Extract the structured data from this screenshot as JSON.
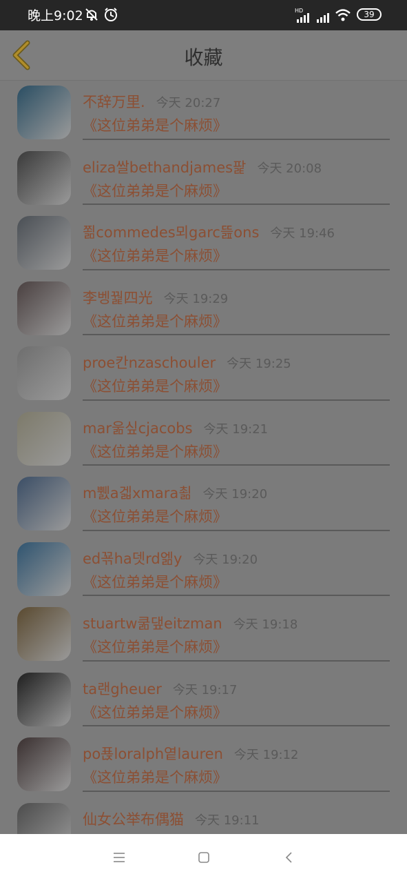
{
  "status": {
    "time": "晚上9:02",
    "battery": "39",
    "icons": [
      "mute-icon",
      "alarm-icon",
      "hd-signal-icon",
      "signal-icon",
      "wifi-icon",
      "battery-icon"
    ]
  },
  "header": {
    "title": "收藏",
    "back_icon": "back-chevron-icon"
  },
  "items": [
    {
      "name": "不辞万里.",
      "time": "今天 20:27",
      "book": "《这位弟弟是个麻烦》",
      "avatar_color": "#2a4e63"
    },
    {
      "name": "eliza쌀bethandjames팙",
      "time": "今天 20:08",
      "book": "《这位弟弟是个麻烦》",
      "avatar_color": "#3a3a3a"
    },
    {
      "name": "쬚commedes뫼garc뜶ons",
      "time": "今天 19:46",
      "book": "《这位弟弟是个麻烦》",
      "avatar_color": "#4a4f55"
    },
    {
      "name": "李벵꿡四光",
      "time": "今天 19:29",
      "book": "《这位弟弟是个麻烦》",
      "avatar_color": "#4a4040"
    },
    {
      "name": "proe칸nzaschouler",
      "time": "今天 19:25",
      "book": "《这位弟弟是个麻烦》",
      "avatar_color": "#6e6e6e"
    },
    {
      "name": "mar욺싶cjacobs",
      "time": "今天 19:21",
      "book": "《这位弟弟是个麻烦》",
      "avatar_color": "#7d7a6a"
    },
    {
      "name": "m쀐a겗xmara쵦",
      "time": "今天 19:20",
      "book": "《这位弟弟是个麻烦》",
      "avatar_color": "#3b4e66"
    },
    {
      "name": "ed꾞ha뎃rd엚y",
      "time": "今天 19:20",
      "book": "《这位弟弟是个麻烦》",
      "avatar_color": "#2f5470"
    },
    {
      "name": "stuartw쿪댚eitzman",
      "time": "今天 19:18",
      "book": "《这位弟弟是个麻烦》",
      "avatar_color": "#5a4a30"
    },
    {
      "name": "ta랜gheuer",
      "time": "今天 19:17",
      "book": "《这位弟弟是个麻烦》",
      "avatar_color": "#1f1f1f"
    },
    {
      "name": "po푡loralph옅lauren",
      "time": "今天 19:12",
      "book": "《这位弟弟是个麻烦》",
      "avatar_color": "#3a3030"
    },
    {
      "name": "仙女公举布偶猫",
      "time": "今天 19:11",
      "book": "",
      "avatar_color": "#4c4c4c"
    }
  ],
  "bottom_nav": [
    "menu-icon",
    "home-icon",
    "back-icon"
  ]
}
